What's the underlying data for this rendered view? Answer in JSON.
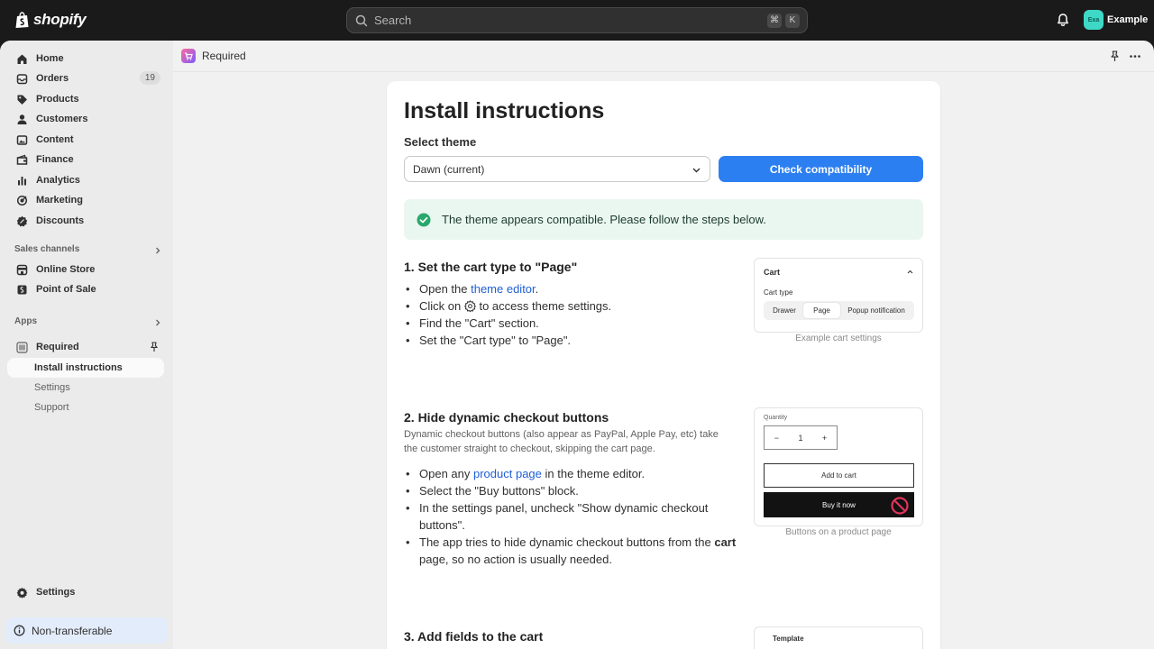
{
  "topbar": {
    "brand": "shopify",
    "search_placeholder": "Search",
    "shortcut_keys": [
      "⌘",
      "K"
    ],
    "avatar_initials": "Exa",
    "store_name": "Example"
  },
  "sidebar": {
    "items": [
      {
        "label": "Home",
        "icon": "home-icon"
      },
      {
        "label": "Orders",
        "icon": "orders-icon",
        "badge": "19"
      },
      {
        "label": "Products",
        "icon": "tag-icon"
      },
      {
        "label": "Customers",
        "icon": "person-icon"
      },
      {
        "label": "Content",
        "icon": "content-icon"
      },
      {
        "label": "Finance",
        "icon": "finance-icon"
      },
      {
        "label": "Analytics",
        "icon": "analytics-icon"
      },
      {
        "label": "Marketing",
        "icon": "marketing-icon"
      },
      {
        "label": "Discounts",
        "icon": "discount-icon"
      }
    ],
    "sales_channels_label": "Sales channels",
    "channels": [
      {
        "label": "Online Store",
        "icon": "store-icon"
      },
      {
        "label": "Point of Sale",
        "icon": "pos-icon"
      }
    ],
    "apps_label": "Apps",
    "app": {
      "label": "Required",
      "subitems": [
        "Install instructions",
        "Settings",
        "Support"
      ]
    },
    "settings_label": "Settings",
    "non_transferable": "Non-transferable"
  },
  "header": {
    "app_title": "Required"
  },
  "main": {
    "title": "Install instructions",
    "select_label": "Select theme",
    "select_value": "Dawn (current)",
    "check_button": "Check compatibility",
    "banner": "The theme appears compatible. Please follow the steps below.",
    "step1": {
      "title": "1. Set the cart type to \"Page\"",
      "b1_pre": "Open the ",
      "b1_link": "theme editor",
      "b1_post": ".",
      "b2_pre": "Click on ",
      "b2_post": " to access theme settings.",
      "b3": "Find the \"Cart\" section.",
      "b4": "Set the \"Cart type\" to \"Page\".",
      "ill_title": "Cart",
      "ill_sub": "Cart type",
      "options": [
        "Drawer",
        "Page",
        "Popup notification"
      ],
      "selected_option": "Page",
      "caption": "Example cart settings"
    },
    "step2": {
      "title": "2. Hide dynamic checkout buttons",
      "desc": "Dynamic checkout buttons (also appear as PayPal, Apple Pay, etc) take the customer straight to checkout, skipping the cart page.",
      "b1_pre": "Open any ",
      "b1_link": "product page",
      "b1_post": " in the theme editor.",
      "b2": "Select the \"Buy buttons\" block.",
      "b3": "In the settings panel, uncheck \"Show dynamic checkout buttons\".",
      "b4_pre": "The app tries to hide dynamic checkout buttons from the ",
      "b4_bold": "cart",
      "b4_post": " page, so no action is usually needed.",
      "qty_label": "Quantity",
      "qty_minus": "−",
      "qty_value": "1",
      "qty_plus": "+",
      "add_to_cart": "Add to cart",
      "buy_now": "Buy it now",
      "caption": "Buttons on a product page"
    },
    "step3": {
      "title": "3. Add fields to the cart",
      "ill_title": "Template"
    }
  },
  "colors": {
    "accent": "#2c7ff1",
    "link": "#1f5fd6",
    "success": "#29a86b",
    "danger": "#e0345a"
  }
}
